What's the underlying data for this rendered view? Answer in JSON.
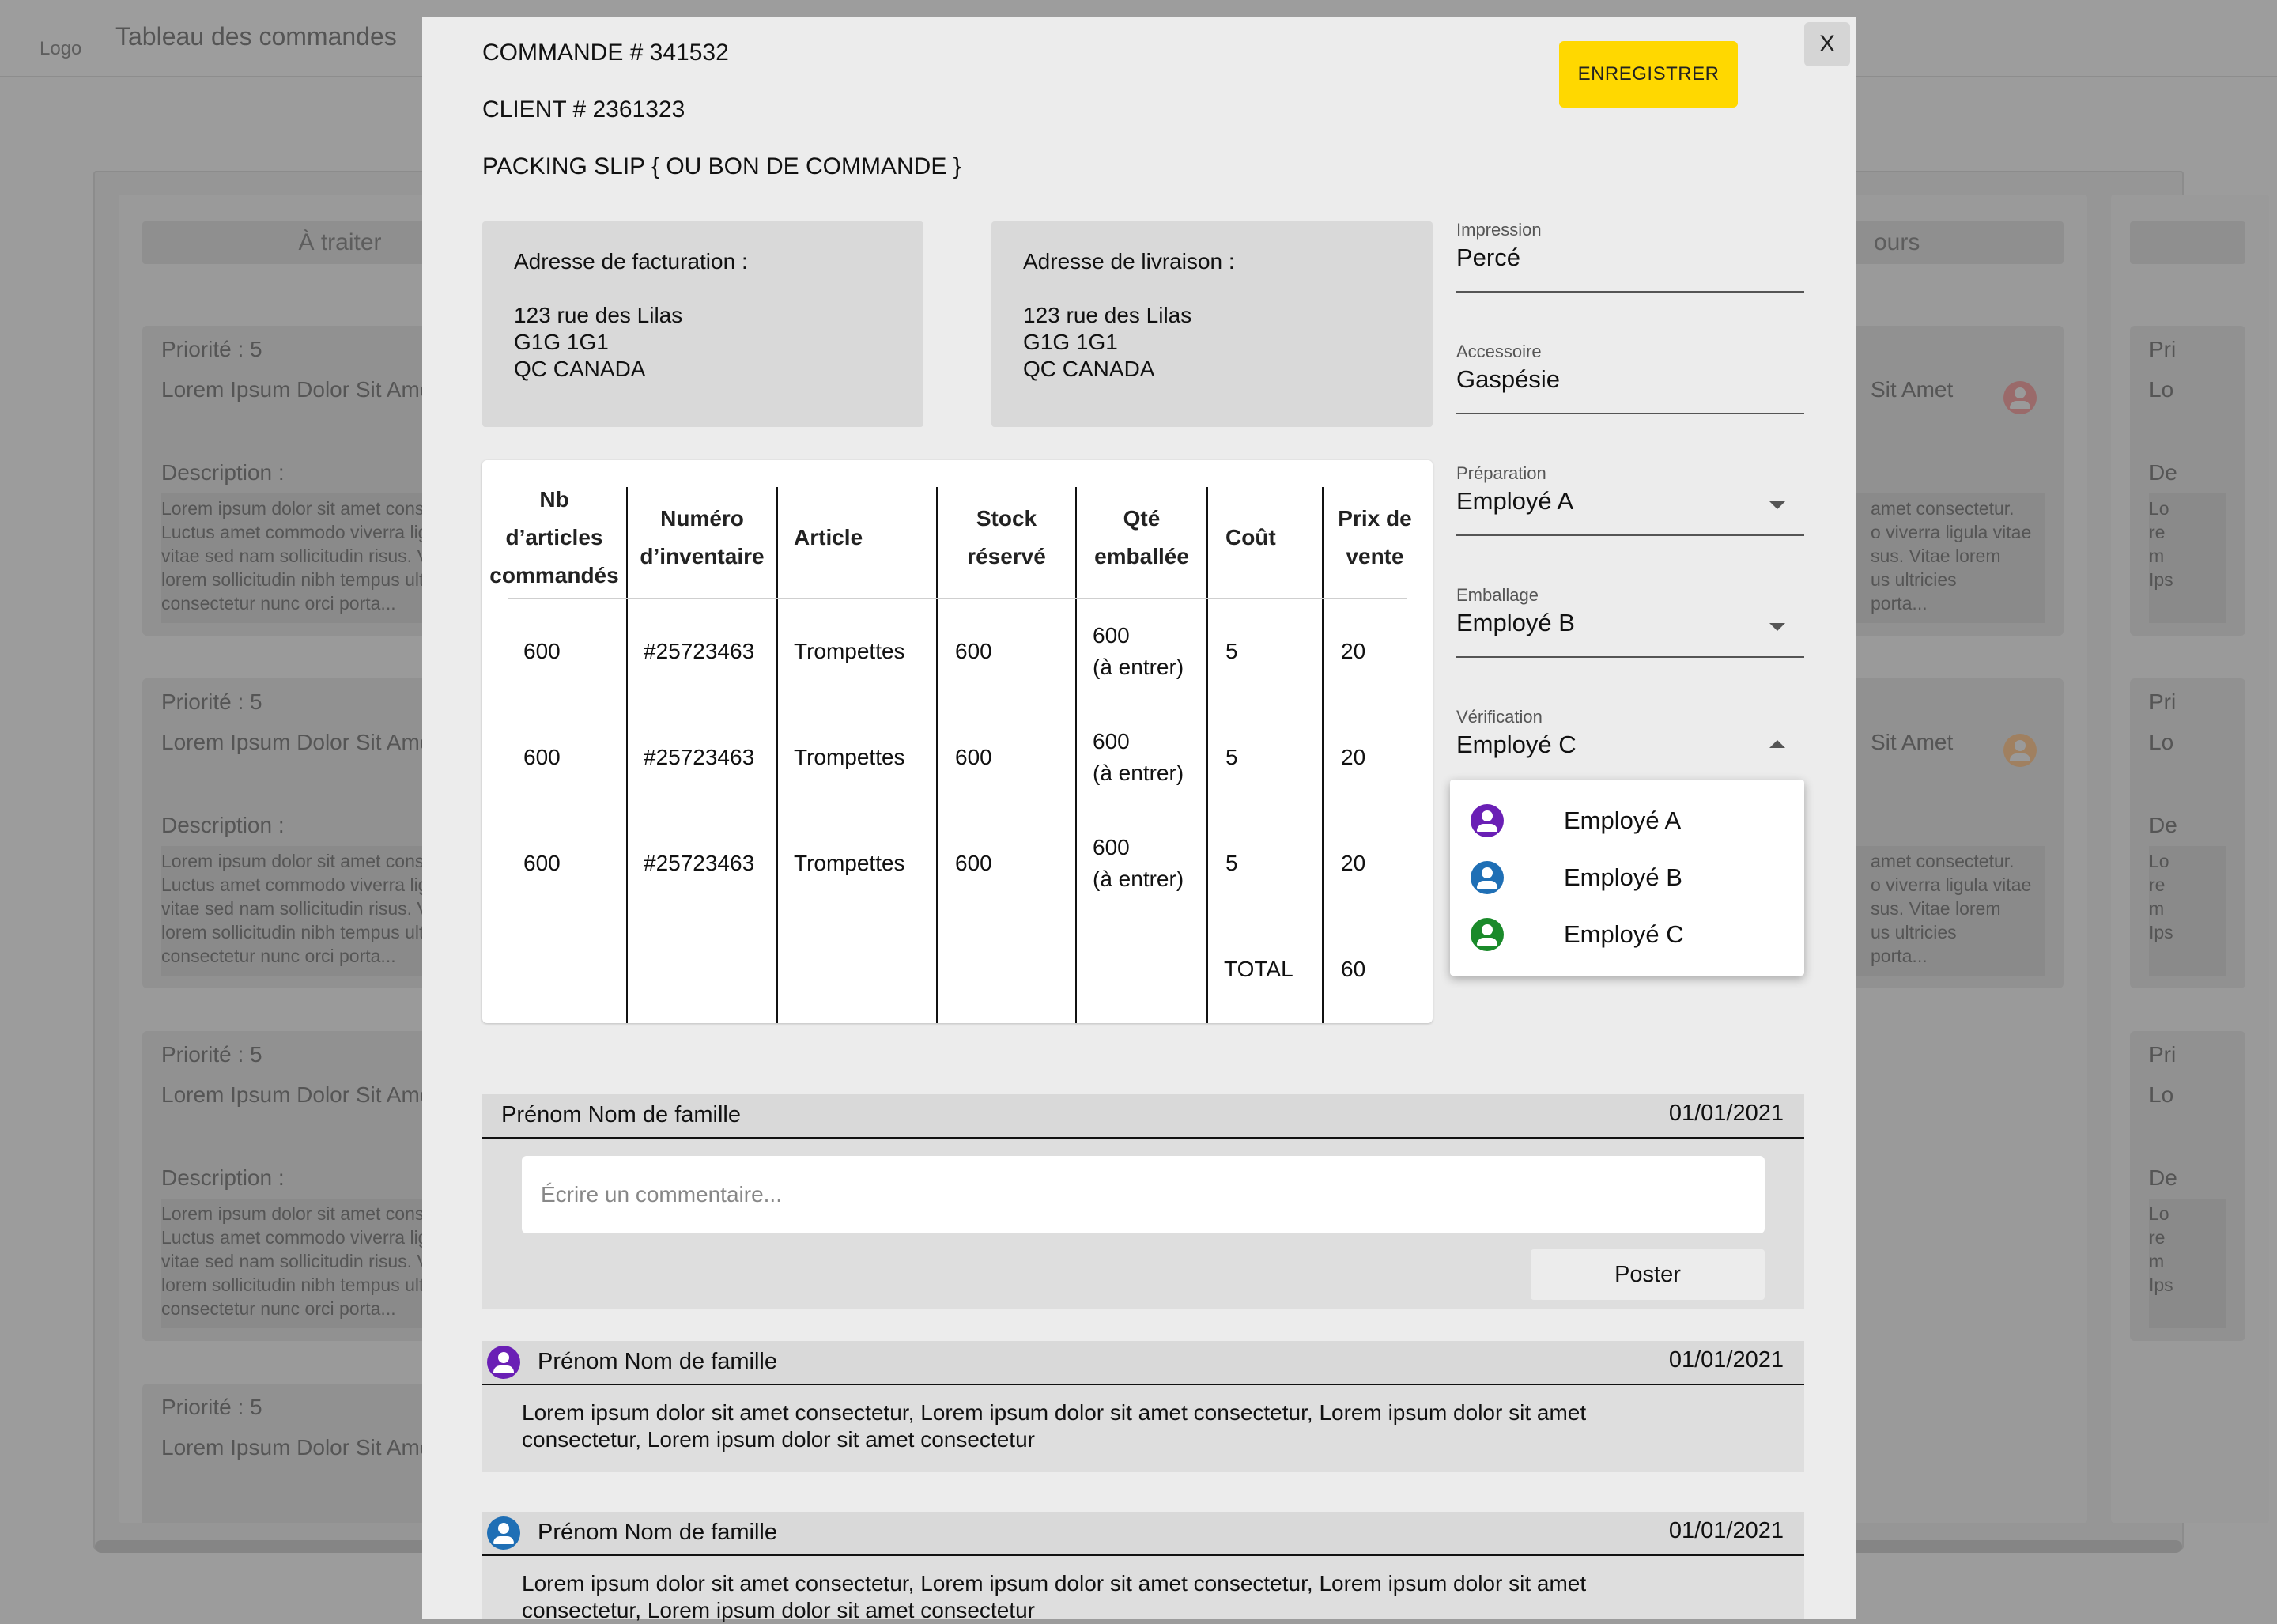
{
  "header": {
    "logo": "Logo",
    "title": "Tableau des commandes"
  },
  "board": {
    "columns": [
      "À traiter",
      "ours"
    ],
    "card": {
      "priority": "Priorité : 5",
      "title": "Lorem Ipsum Dolor Sit Amet Consectetur.",
      "title_right": "Sit Amet",
      "description_label": "Description :",
      "description": "Lorem ipsum dolor sit amet consectetur. Luctus amet commodo viverra ligula vitae vitae sed nam sollicitudin risus. Vitae lorem lorem sollicitudin nibh tempus ultricies consectetur nunc orci porta...",
      "right_desc": "amet consectetur.\no viverra ligula vitae\nsus. Vitae lorem\nus ultricies\nporta...",
      "far_prio": "Pri",
      "far_title": "Lo",
      "far_desc_label": "De",
      "far_desc": "Lo\nre\nm\nIps"
    },
    "colors": {
      "avatar1": "#9a6a6a",
      "avatar2": "#a08060"
    }
  },
  "modal": {
    "close_label": "X",
    "order": "COMMANDE # 341532",
    "client": "CLIENT # 2361323",
    "slip": "PACKING SLIP { OU BON DE COMMANDE }",
    "save_label": "ENREGISTRER",
    "billing": {
      "label": "Adresse de facturation :",
      "line1": "123 rue des Lilas",
      "line2": "G1G 1G1",
      "line3": "QC CANADA"
    },
    "shipping": {
      "label": "Adresse de livraison :",
      "line1": "123 rue des Lilas",
      "line2": "G1G 1G1",
      "line3": "QC CANADA"
    },
    "fields": {
      "impression": {
        "label": "Impression",
        "value": "Percé"
      },
      "accessoire": {
        "label": "Accessoire",
        "value": "Gaspésie"
      },
      "preparation": {
        "label": "Préparation",
        "value": "Employé A"
      },
      "emballage": {
        "label": "Emballage",
        "value": "Employé B"
      },
      "verification": {
        "label": "Vérification",
        "value": "Employé C"
      }
    },
    "dropdown": {
      "options": [
        {
          "label": "Employé A",
          "color": "#6a1fb5"
        },
        {
          "label": "Employé B",
          "color": "#1f6fb5"
        },
        {
          "label": "Employé C",
          "color": "#1a8a2a"
        }
      ]
    },
    "table": {
      "headers": [
        "Nb d’articles commandés",
        "Numéro d’inventaire",
        "Article",
        "Stock réservé",
        "Qté emballée",
        "Coût",
        "Prix de vente"
      ],
      "header_lines": [
        [
          "Nb",
          "d’articles",
          "commandés"
        ],
        [
          "Numéro",
          "d’inventaire"
        ],
        [
          "Article"
        ],
        [
          "Stock",
          "réservé"
        ],
        [
          "Qté",
          "emballée"
        ],
        [
          "Coût"
        ],
        [
          "Prix de",
          "vente"
        ]
      ],
      "rows": [
        {
          "nb": "600",
          "inv": "#25723463",
          "article": "Trompettes",
          "stock": "600",
          "qty1": "600",
          "qty2": "(à entrer)",
          "cout": "5",
          "prix": "20"
        },
        {
          "nb": "600",
          "inv": "#25723463",
          "article": "Trompettes",
          "stock": "600",
          "qty1": "600",
          "qty2": "(à entrer)",
          "cout": "5",
          "prix": "20"
        },
        {
          "nb": "600",
          "inv": "#25723463",
          "article": "Trompettes",
          "stock": "600",
          "qty1": "600",
          "qty2": "(à entrer)",
          "cout": "5",
          "prix": "20"
        }
      ],
      "total_label": "TOTAL",
      "total_value": "60"
    },
    "comment_form": {
      "author": "Prénom Nom de famille",
      "date": "01/01/2021",
      "placeholder": "Écrire un commentaire...",
      "post_label": "Poster"
    },
    "comments": [
      {
        "author": "Prénom Nom de famille",
        "date": "01/01/2021",
        "avatar_color": "#6a1fb5",
        "line1": "Lorem ipsum dolor sit amet consectetur, Lorem ipsum dolor sit amet consectetur, Lorem ipsum dolor sit amet",
        "line2": "consectetur, Lorem ipsum dolor sit amet consectetur"
      },
      {
        "author": "Prénom Nom de famille",
        "date": "01/01/2021",
        "avatar_color": "#1f6fb5",
        "line1": "Lorem ipsum dolor sit amet consectetur, Lorem ipsum dolor sit amet consectetur, Lorem ipsum dolor sit amet",
        "line2": "consectetur, Lorem ipsum dolor sit amet consectetur"
      }
    ]
  }
}
